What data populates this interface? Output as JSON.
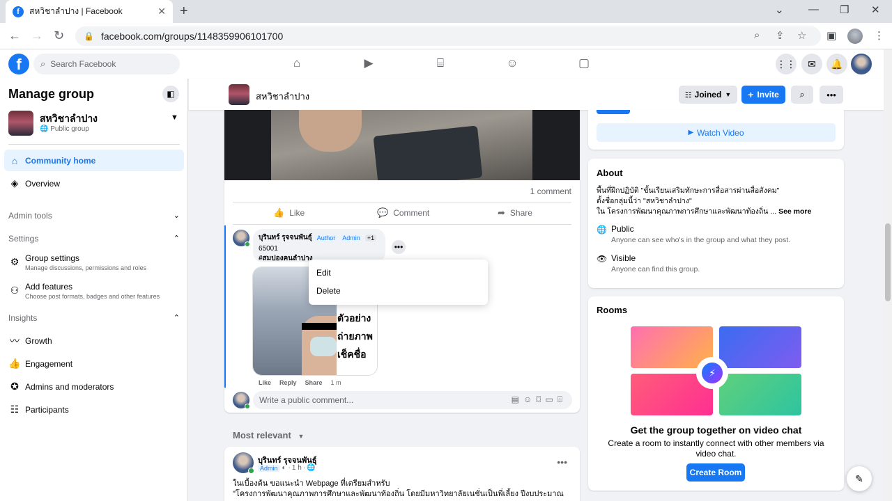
{
  "browser": {
    "tab_title": "สหวิชาลำปาง | Facebook",
    "url": "facebook.com/groups/1148359906101700",
    "favicon_letter": "f"
  },
  "fb_nav": {
    "search_placeholder": "Search Facebook"
  },
  "sidebar": {
    "title": "Manage group",
    "group_name": "สหวิชาลำปาง",
    "group_privacy": "Public group",
    "items": [
      {
        "label": "Community home",
        "icon": "home-icon",
        "active": true
      },
      {
        "label": "Overview",
        "icon": "layers-icon"
      }
    ],
    "admin_tools": "Admin tools",
    "settings": "Settings",
    "settings_items": [
      {
        "label": "Group settings",
        "sub": "Manage discussions, permissions and roles"
      },
      {
        "label": "Add features",
        "sub": "Choose post formats, badges and other features"
      }
    ],
    "insights": "Insights",
    "insights_items": [
      {
        "label": "Growth"
      },
      {
        "label": "Engagement"
      },
      {
        "label": "Admins and moderators"
      },
      {
        "label": "Participants"
      }
    ]
  },
  "group_bar": {
    "name": "สหวิชาลำปาง",
    "joined_label": "Joined",
    "invite_label": "Invite"
  },
  "post": {
    "comment_count": "1 comment",
    "like": "Like",
    "comment": "Comment",
    "share": "Share",
    "comment_item": {
      "author": "บุรินทร์ รุจจนพันธุ์",
      "badges": [
        "Author",
        "Admin",
        "+1"
      ],
      "line1": "65001",
      "tag": "#สมปองคนลำปาง",
      "image_text": "ตัวอย่าง ถ่ายภาพ เช็คชื่อ",
      "like": "Like",
      "reply": "Reply",
      "share": "Share",
      "time": "1 m"
    },
    "write_placeholder": "Write a public comment..."
  },
  "context_menu": {
    "edit": "Edit",
    "delete": "Delete"
  },
  "feed": {
    "sort_label": "Most relevant",
    "post2": {
      "author": "บุรินทร์ รุจจนพันธุ์",
      "role": "Admin",
      "time": "1 h",
      "text_line1": "ในเบื้องต้น ขอแนะนำ Webpage ที่เตรียมสำหรับ",
      "text_line2": "\"โครงการพัฒนาคุณภาพการศึกษาและพัฒนาท้องถิ่น โดยมีมหาวิทยาลัยเนชั่นเป็นพี่เลี้ยง ปีงบประมาณ"
    }
  },
  "right": {
    "watch_video": "Watch Video",
    "about": {
      "title": "About",
      "desc_line1": "พื้นที่ฝึกปฏิบัติ \"ขั้นเรียนเสริมทักษะการสื่อสารผ่านสื่อสังคม\"",
      "desc_line2": "ตั้งชื่อกลุ่มนี้ว่า \"สหวิชาลำปาง\"",
      "desc_line3": "ใน โครงการพัฒนาคุณภาพการศึกษาและพัฒนาท้องถิ่น ...",
      "see_more": "See more",
      "public_title": "Public",
      "public_sub": "Anyone can see who's in the group and what they post.",
      "visible_title": "Visible",
      "visible_sub": "Anyone can find this group."
    },
    "rooms": {
      "title": "Rooms",
      "headline": "Get the group together on video chat",
      "sub": "Create a room to instantly connect with other members via video chat.",
      "button": "Create Room"
    }
  },
  "colors": {
    "fb_blue": "#1877f2",
    "bg": "#f0f2f5",
    "active_bg": "#e7f3ff"
  }
}
